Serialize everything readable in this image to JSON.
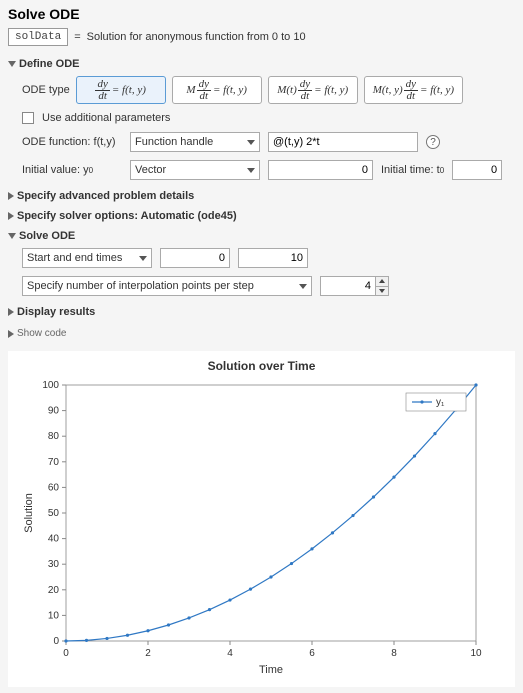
{
  "title": "Solve ODE",
  "var_name": "solData",
  "subtitle_prefix": "=",
  "subtitle": "Solution for anonymous function from 0 to 10",
  "sections": {
    "define_ode": "Define ODE",
    "advanced": "Specify advanced problem details",
    "solver_opts": "Specify solver options: Automatic (ode45)",
    "solve_ode": "Solve ODE",
    "display": "Display results",
    "show_code": "Show code"
  },
  "ode_type_label": "ODE type",
  "use_additional_label": "Use additional parameters",
  "ode_func_label": "ODE function: f(t,y)",
  "ode_func_dropdown": "Function handle",
  "ode_func_value": "@(t,y) 2*t",
  "initial_value_label": "Initial value:  y",
  "initial_value_sub": "0",
  "initial_value_dropdown": "Vector",
  "initial_value_input": "0",
  "initial_time_label": "Initial time:  t",
  "initial_time_sub": "0",
  "initial_time_value": "0",
  "times_dropdown": "Start and end times",
  "time_start": "0",
  "time_end": "10",
  "interp_label": "Specify number of interpolation points per step",
  "interp_value": "4",
  "chart_data": {
    "type": "line",
    "title": "Solution over Time",
    "xlabel": "Time",
    "ylabel": "Solution",
    "xlim": [
      0,
      10
    ],
    "ylim": [
      0,
      100
    ],
    "xticks": [
      0,
      2,
      4,
      6,
      8,
      10
    ],
    "yticks": [
      0,
      10,
      20,
      30,
      40,
      50,
      60,
      70,
      80,
      90,
      100
    ],
    "legend": [
      "y₁"
    ],
    "series": [
      {
        "name": "y1",
        "x": [
          0,
          0.5,
          1,
          1.5,
          2,
          2.5,
          3,
          3.5,
          4,
          4.5,
          5,
          5.5,
          6,
          6.5,
          7,
          7.5,
          8,
          8.5,
          9,
          9.5,
          10
        ],
        "y": [
          0,
          0.25,
          1,
          2.25,
          4,
          6.25,
          9,
          12.25,
          16,
          20.25,
          25,
          30.25,
          36,
          42.25,
          49,
          56.25,
          64,
          72.25,
          81,
          90.25,
          100
        ]
      }
    ]
  }
}
